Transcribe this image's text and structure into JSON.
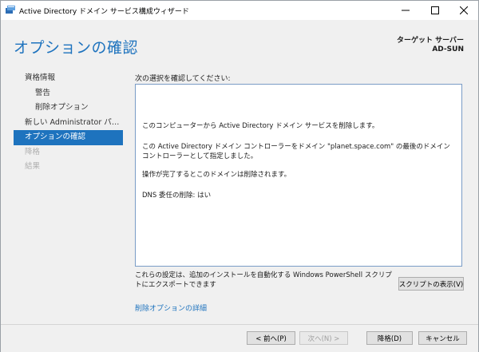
{
  "window": {
    "title": "Active Directory ドメイン サービス構成ウィザード"
  },
  "header": {
    "page_title": "オプションの確認",
    "target_label": "ターゲット サーバー",
    "target_name": "AD-SUN"
  },
  "nav": {
    "items": [
      {
        "label": "資格情報",
        "state": "normal"
      },
      {
        "label": "警告",
        "state": "normal"
      },
      {
        "label": "削除オプション",
        "state": "normal"
      },
      {
        "label": "新しい Administrator パス...",
        "state": "normal"
      },
      {
        "label": "オプションの確認",
        "state": "active"
      },
      {
        "label": "降格",
        "state": "disabled"
      },
      {
        "label": "結果",
        "state": "disabled"
      }
    ]
  },
  "content": {
    "instruction": "次の選択を確認してください:",
    "summary": [
      "このコンピューターから Active Directory ドメイン サービスを削除します。",
      "この Active Directory ドメイン コントローラーをドメイン \"planet.space.com\" の最後のドメイン コントローラーとして指定しました。",
      "操作が完了するとこのドメインは削除されます。",
      "DNS 委任の削除: はい"
    ],
    "ps_note": "これらの設定は、追加のインストールを自動化する Windows PowerShell スクリプトにエクスポートできます",
    "view_script_label": "スクリプトの表示(V)",
    "details_link": "削除オプションの詳細"
  },
  "footer": {
    "prev_label": "< 前へ(P)",
    "next_label": "次へ(N) >",
    "remove_label": "降格(D)",
    "cancel_label": "キャンセル"
  },
  "icons": {
    "app": "server-role-icon",
    "minimize": "minimize-icon",
    "maximize": "maximize-icon",
    "close": "close-icon"
  },
  "colors": {
    "accent": "#1e73be",
    "nav_active_bg": "#1e73be",
    "window_bg": "#f0f0f0"
  }
}
